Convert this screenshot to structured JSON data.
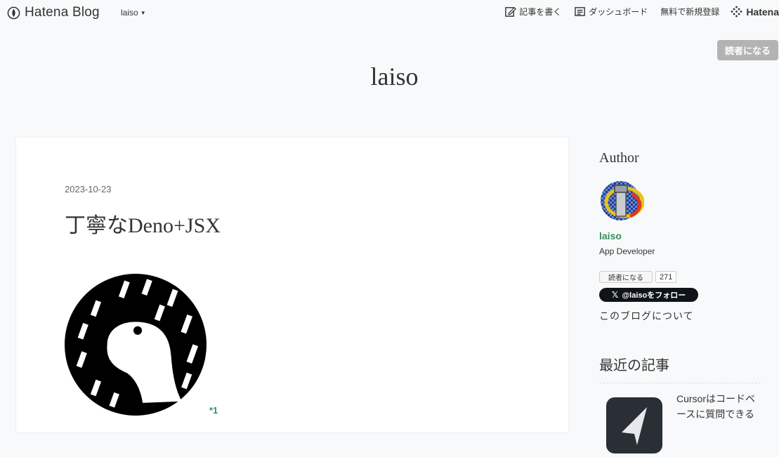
{
  "topbar": {
    "brand": "Hatena Blog",
    "blog_menu": "laiso",
    "write_label": "記事を書く",
    "dashboard_label": "ダッシュボード",
    "signup_label": "無料で新規登録",
    "hatena_label": "Hatena"
  },
  "subscribe_button": "読者になる",
  "site_title": "laiso",
  "article": {
    "date": "2023-10-23",
    "title": "丁寧なDeno+JSX",
    "footnote": "*1"
  },
  "sidebar": {
    "author_heading": "Author",
    "author_name": "laiso",
    "author_desc": "App Developer",
    "subscribe_label": "読者になる",
    "subscriber_count": "271",
    "follow_label": "@laisoをフォロー",
    "about_link": "このブログについて",
    "recent_heading": "最近の記事",
    "recent_item": "Cursorはコードベースに質問できる"
  },
  "colors": {
    "accent_green": "#3a8f5e",
    "follow_bg": "#0f1419",
    "subscribe_bg": "#b3b3b3"
  }
}
